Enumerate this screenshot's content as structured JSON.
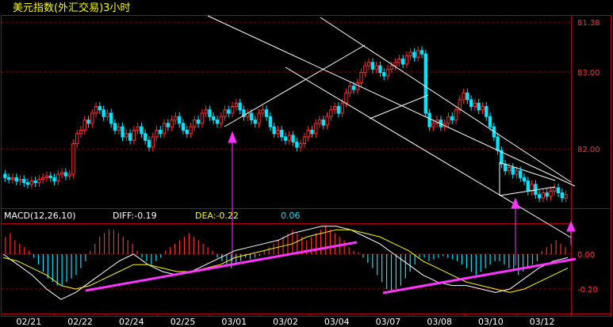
{
  "window": {
    "title": "美元指数(外汇交易)3小时"
  },
  "colors": {
    "background": "#000000",
    "frame": "#b00000",
    "grid": "#8a0000",
    "up": "#ff2a2a",
    "down": "#00e6ff",
    "trendline": "#ffffff",
    "annotation": "#ff33ff",
    "title": "#ffff00",
    "diff": "#ffffff",
    "dea": "#ffff00",
    "macd_value": "#00e6ff",
    "axis_label": "#ff3030",
    "date_label": "#ffffff"
  },
  "chart_data": {
    "type": "candlestick",
    "price_axis": {
      "ticks": [
        {
          "value": 81.38,
          "label": "81.38"
        },
        {
          "value": 83.0,
          "label": "83.00"
        },
        {
          "value": 82.0,
          "label": "82.00"
        }
      ]
    },
    "dates": [
      "02/21",
      "02/22",
      "02/24",
      "02/25",
      "03/01",
      "03/02",
      "03/04",
      "03/07",
      "03/08",
      "03/10",
      "03/12"
    ],
    "candles": [
      {
        "o": 0.14,
        "c": 0.12
      },
      {
        "o": 0.12,
        "c": 0.11
      },
      {
        "o": 0.11,
        "c": 0.12
      },
      {
        "o": 0.12,
        "c": 0.1
      },
      {
        "o": 0.1,
        "c": 0.11
      },
      {
        "o": 0.11,
        "c": 0.09
      },
      {
        "o": 0.09,
        "c": 0.08
      },
      {
        "o": 0.08,
        "c": 0.1
      },
      {
        "o": 0.1,
        "c": 0.09
      },
      {
        "o": 0.09,
        "c": 0.11
      },
      {
        "o": 0.11,
        "c": 0.12
      },
      {
        "o": 0.12,
        "c": 0.13
      },
      {
        "o": 0.13,
        "c": 0.12
      },
      {
        "o": 0.12,
        "c": 0.1
      },
      {
        "o": 0.1,
        "c": 0.14
      },
      {
        "o": 0.14,
        "c": 0.15
      },
      {
        "o": 0.15,
        "c": 0.13
      },
      {
        "o": 0.13,
        "c": 0.14
      },
      {
        "o": 0.14,
        "c": 0.32
      },
      {
        "o": 0.32,
        "c": 0.38
      },
      {
        "o": 0.38,
        "c": 0.4
      },
      {
        "o": 0.4,
        "c": 0.46
      },
      {
        "o": 0.46,
        "c": 0.44
      },
      {
        "o": 0.44,
        "c": 0.5
      },
      {
        "o": 0.5,
        "c": 0.54
      },
      {
        "o": 0.54,
        "c": 0.52
      },
      {
        "o": 0.52,
        "c": 0.48
      },
      {
        "o": 0.48,
        "c": 0.5
      },
      {
        "o": 0.5,
        "c": 0.44
      },
      {
        "o": 0.44,
        "c": 0.4
      },
      {
        "o": 0.4,
        "c": 0.42
      },
      {
        "o": 0.42,
        "c": 0.36
      },
      {
        "o": 0.36,
        "c": 0.38
      },
      {
        "o": 0.38,
        "c": 0.34
      },
      {
        "o": 0.34,
        "c": 0.4
      },
      {
        "o": 0.4,
        "c": 0.42
      },
      {
        "o": 0.42,
        "c": 0.38
      },
      {
        "o": 0.38,
        "c": 0.34
      },
      {
        "o": 0.34,
        "c": 0.3
      },
      {
        "o": 0.3,
        "c": 0.36
      },
      {
        "o": 0.36,
        "c": 0.4
      },
      {
        "o": 0.4,
        "c": 0.38
      },
      {
        "o": 0.38,
        "c": 0.44
      },
      {
        "o": 0.44,
        "c": 0.42
      },
      {
        "o": 0.42,
        "c": 0.46
      },
      {
        "o": 0.46,
        "c": 0.48
      },
      {
        "o": 0.48,
        "c": 0.44
      },
      {
        "o": 0.44,
        "c": 0.4
      },
      {
        "o": 0.4,
        "c": 0.38
      },
      {
        "o": 0.38,
        "c": 0.42
      },
      {
        "o": 0.42,
        "c": 0.46
      },
      {
        "o": 0.46,
        "c": 0.44
      },
      {
        "o": 0.44,
        "c": 0.5
      },
      {
        "o": 0.5,
        "c": 0.52
      },
      {
        "o": 0.52,
        "c": 0.48
      },
      {
        "o": 0.48,
        "c": 0.46
      },
      {
        "o": 0.46,
        "c": 0.44
      },
      {
        "o": 0.44,
        "c": 0.48
      },
      {
        "o": 0.48,
        "c": 0.52
      },
      {
        "o": 0.52,
        "c": 0.5
      },
      {
        "o": 0.5,
        "c": 0.54
      },
      {
        "o": 0.54,
        "c": 0.56
      },
      {
        "o": 0.56,
        "c": 0.52
      },
      {
        "o": 0.52,
        "c": 0.48
      },
      {
        "o": 0.48,
        "c": 0.5
      },
      {
        "o": 0.5,
        "c": 0.46
      },
      {
        "o": 0.46,
        "c": 0.44
      },
      {
        "o": 0.44,
        "c": 0.5
      },
      {
        "o": 0.5,
        "c": 0.52
      },
      {
        "o": 0.52,
        "c": 0.48
      },
      {
        "o": 0.48,
        "c": 0.42
      },
      {
        "o": 0.42,
        "c": 0.38
      },
      {
        "o": 0.38,
        "c": 0.4
      },
      {
        "o": 0.4,
        "c": 0.36
      },
      {
        "o": 0.36,
        "c": 0.34
      },
      {
        "o": 0.34,
        "c": 0.37
      },
      {
        "o": 0.37,
        "c": 0.33
      },
      {
        "o": 0.33,
        "c": 0.3
      },
      {
        "o": 0.3,
        "c": 0.32
      },
      {
        "o": 0.32,
        "c": 0.36
      },
      {
        "o": 0.36,
        "c": 0.4
      },
      {
        "o": 0.4,
        "c": 0.38
      },
      {
        "o": 0.38,
        "c": 0.44
      },
      {
        "o": 0.44,
        "c": 0.46
      },
      {
        "o": 0.46,
        "c": 0.43
      },
      {
        "o": 0.43,
        "c": 0.48
      },
      {
        "o": 0.48,
        "c": 0.52
      },
      {
        "o": 0.52,
        "c": 0.54
      },
      {
        "o": 0.54,
        "c": 0.5
      },
      {
        "o": 0.5,
        "c": 0.56
      },
      {
        "o": 0.56,
        "c": 0.62
      },
      {
        "o": 0.62,
        "c": 0.66
      },
      {
        "o": 0.66,
        "c": 0.64
      },
      {
        "o": 0.64,
        "c": 0.68
      },
      {
        "o": 0.68,
        "c": 0.74
      },
      {
        "o": 0.74,
        "c": 0.78
      },
      {
        "o": 0.78,
        "c": 0.8
      },
      {
        "o": 0.8,
        "c": 0.76
      },
      {
        "o": 0.76,
        "c": 0.78
      },
      {
        "o": 0.78,
        "c": 0.74
      },
      {
        "o": 0.74,
        "c": 0.72
      },
      {
        "o": 0.72,
        "c": 0.76
      },
      {
        "o": 0.76,
        "c": 0.78
      },
      {
        "o": 0.78,
        "c": 0.8
      },
      {
        "o": 0.8,
        "c": 0.82
      },
      {
        "o": 0.82,
        "c": 0.79
      },
      {
        "o": 0.79,
        "c": 0.84
      },
      {
        "o": 0.84,
        "c": 0.86
      },
      {
        "o": 0.86,
        "c": 0.83
      },
      {
        "o": 0.83,
        "c": 0.87
      },
      {
        "o": 0.87,
        "c": 0.85
      },
      {
        "o": 0.85,
        "c": 0.5
      },
      {
        "o": 0.5,
        "c": 0.42
      },
      {
        "o": 0.42,
        "c": 0.44
      },
      {
        "o": 0.44,
        "c": 0.46
      },
      {
        "o": 0.46,
        "c": 0.42
      },
      {
        "o": 0.42,
        "c": 0.44
      },
      {
        "o": 0.44,
        "c": 0.48
      },
      {
        "o": 0.48,
        "c": 0.46
      },
      {
        "o": 0.46,
        "c": 0.52
      },
      {
        "o": 0.52,
        "c": 0.58
      },
      {
        "o": 0.58,
        "c": 0.62
      },
      {
        "o": 0.62,
        "c": 0.58
      },
      {
        "o": 0.58,
        "c": 0.54
      },
      {
        "o": 0.54,
        "c": 0.56
      },
      {
        "o": 0.56,
        "c": 0.52
      },
      {
        "o": 0.52,
        "c": 0.54
      },
      {
        "o": 0.54,
        "c": 0.48
      },
      {
        "o": 0.48,
        "c": 0.42
      },
      {
        "o": 0.42,
        "c": 0.36
      },
      {
        "o": 0.36,
        "c": 0.28
      },
      {
        "o": 0.28,
        "c": 0.2
      },
      {
        "o": 0.2,
        "c": 0.16
      },
      {
        "o": 0.16,
        "c": 0.18
      },
      {
        "o": 0.18,
        "c": 0.14
      },
      {
        "o": 0.14,
        "c": 0.16
      },
      {
        "o": 0.16,
        "c": 0.12
      },
      {
        "o": 0.12,
        "c": 0.1
      },
      {
        "o": 0.1,
        "c": 0.04
      },
      {
        "o": 0.04,
        "c": 0.08
      },
      {
        "o": 0.08,
        "c": 0.02
      },
      {
        "o": 0.02,
        "c": 0.0
      },
      {
        "o": 0.0,
        "c": 0.03
      },
      {
        "o": 0.03,
        "c": 0.01
      },
      {
        "o": 0.01,
        "c": 0.04
      },
      {
        "o": 0.04,
        "c": 0.06
      },
      {
        "o": 0.06,
        "c": 0.03
      },
      {
        "o": 0.03,
        "c": 0.0
      },
      {
        "o": 0.0,
        "c": 0.02
      }
    ],
    "macd": {
      "label": "MACD(12,26,10)",
      "diff_label": "DIFF:-0.19",
      "dea_label": "DEA:-0.22",
      "value_label": "0.06",
      "ticks": [
        {
          "value": 0.0,
          "label": "0.00"
        },
        {
          "value": -0.2,
          "label": "-0.20"
        }
      ],
      "bars": [
        0.1,
        0.12,
        0.08,
        0.06,
        0.04,
        0.02,
        -0.02,
        -0.06,
        -0.1,
        -0.14,
        -0.16,
        -0.18,
        -0.18,
        -0.16,
        -0.14,
        -0.12,
        -0.08,
        -0.04,
        0.02,
        0.06,
        0.1,
        0.12,
        0.14,
        0.14,
        0.12,
        0.1,
        0.08,
        0.06,
        0.02,
        -0.02,
        -0.04,
        -0.06,
        -0.04,
        -0.02,
        0.02,
        0.04,
        0.06,
        0.08,
        0.1,
        0.12,
        0.1,
        0.08,
        0.06,
        0.04,
        0.02,
        -0.02,
        -0.04,
        -0.06,
        -0.08,
        -0.06,
        -0.04,
        -0.02,
        -0.03,
        -0.02,
        -0.01,
        0.02,
        0.04,
        0.06,
        0.08,
        0.1,
        0.12,
        0.14,
        0.12,
        0.1,
        0.08,
        0.1,
        0.12,
        0.14,
        0.16,
        0.14,
        0.12,
        0.1,
        0.08,
        0.04,
        0.02,
        0.01,
        -0.02,
        -0.05,
        -0.08,
        -0.12,
        -0.16,
        -0.2,
        -0.22,
        -0.2,
        -0.18,
        -0.14,
        -0.1,
        -0.06,
        -0.02,
        -0.02,
        -0.04,
        -0.03,
        -0.02,
        -0.01,
        -0.02,
        -0.03,
        -0.04,
        -0.06,
        -0.08,
        -0.1,
        -0.12,
        -0.1,
        -0.08,
        -0.06,
        -0.04,
        -0.04,
        -0.06,
        -0.08,
        -0.1,
        -0.12,
        -0.1,
        -0.08,
        -0.06,
        -0.04,
        0.02,
        0.04,
        0.06,
        0.08,
        0.06,
        0.04
      ],
      "diff": [
        0.0,
        -0.06,
        -0.12,
        -0.2,
        -0.26,
        -0.22,
        -0.16,
        -0.1,
        -0.04,
        0.0,
        -0.06,
        -0.1,
        -0.12,
        -0.1,
        -0.06,
        -0.02,
        0.02,
        0.04,
        0.06,
        0.08,
        0.12,
        0.14,
        0.16,
        0.16,
        0.14,
        0.1,
        0.06,
        0.0,
        -0.06,
        -0.12,
        -0.16,
        -0.18,
        -0.18,
        -0.2,
        -0.22,
        -0.2,
        -0.14,
        -0.08,
        -0.04,
        -0.02
      ],
      "dea": [
        -0.02,
        -0.04,
        -0.08,
        -0.12,
        -0.18,
        -0.2,
        -0.18,
        -0.14,
        -0.1,
        -0.06,
        -0.06,
        -0.08,
        -0.1,
        -0.1,
        -0.08,
        -0.06,
        -0.02,
        0.0,
        0.02,
        0.04,
        0.06,
        0.1,
        0.12,
        0.14,
        0.14,
        0.12,
        0.1,
        0.06,
        0.02,
        -0.04,
        -0.08,
        -0.12,
        -0.16,
        -0.18,
        -0.2,
        -0.22,
        -0.2,
        -0.16,
        -0.12,
        -0.08
      ]
    }
  }
}
